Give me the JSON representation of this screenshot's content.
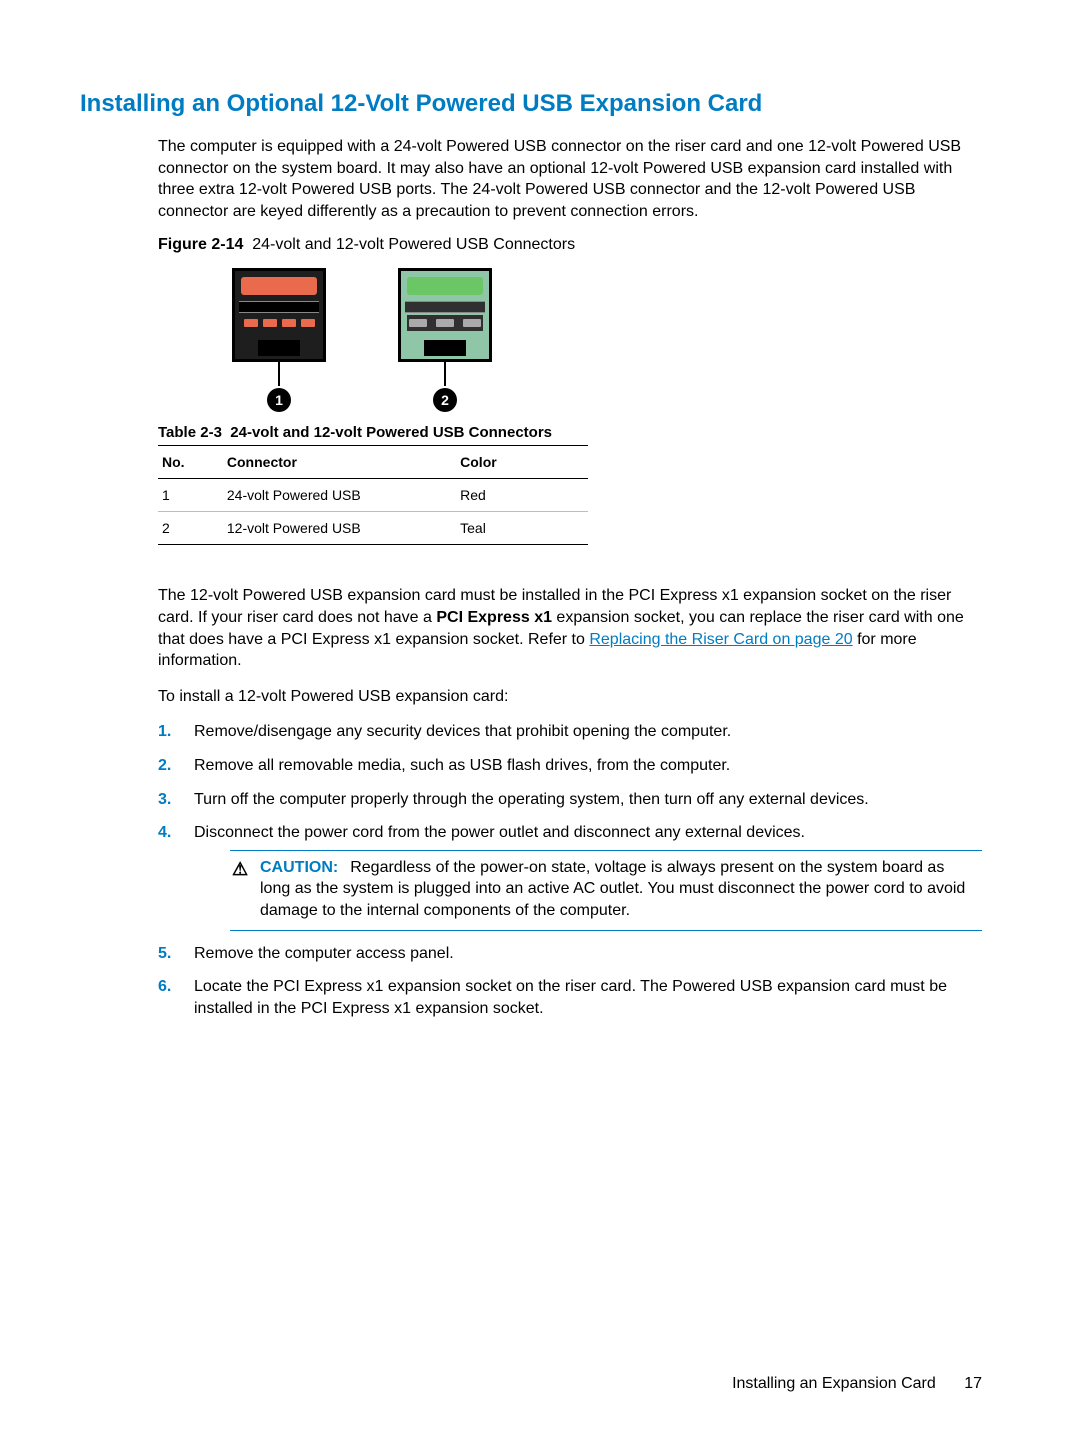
{
  "heading": "Installing an Optional 12-Volt Powered USB Expansion Card",
  "intro": "The computer is equipped with a 24-volt Powered USB connector on the riser card and one 12-volt Powered USB connector on the system board. It may also have an optional 12-volt Powered USB expansion card installed with three extra 12-volt Powered USB ports. The 24-volt Powered USB connector and the 12-volt Powered USB connector are keyed differently as a precaution to prevent connection errors.",
  "figure": {
    "number": "Figure 2-14",
    "caption": "24-volt and 12-volt Powered USB Connectors",
    "callouts": [
      "1",
      "2"
    ]
  },
  "table": {
    "number": "Table 2-3",
    "caption": "24-volt and 12-volt Powered USB Connectors",
    "headers": {
      "no": "No.",
      "connector": "Connector",
      "color": "Color"
    },
    "rows": [
      {
        "no": "1",
        "connector": "24-volt Powered USB",
        "color": "Red"
      },
      {
        "no": "2",
        "connector": "12-volt Powered USB",
        "color": "Teal"
      }
    ]
  },
  "para2": {
    "pre": "The 12-volt Powered USB expansion card must be installed in the PCI Express x1 expansion socket on the riser card. If your riser card does not have a ",
    "bold": "PCI Express x1",
    "mid": " expansion socket, you can replace the riser card with one that does have a PCI Express x1 expansion socket. Refer to ",
    "link": "Replacing the Riser Card on page 20",
    "post": " for more information."
  },
  "para3": "To install a 12-volt Powered USB expansion card:",
  "steps": [
    "Remove/disengage any security devices that prohibit opening the computer.",
    "Remove all removable media, such as USB flash drives, from the computer.",
    "Turn off the computer properly through the operating system, then turn off any external devices.",
    "Disconnect the power cord from the power outlet and disconnect any external devices.",
    "Remove the computer access panel.",
    "Locate the PCI Express x1 expansion socket on the riser card. The Powered USB expansion card must be installed in the PCI Express x1 expansion socket."
  ],
  "caution": {
    "label": "CAUTION:",
    "text": "Regardless of the power-on state, voltage is always present on the system board as long as the system is plugged into an active AC outlet. You must disconnect the power cord to avoid damage to the internal components of the computer."
  },
  "footer": {
    "section": "Installing an Expansion Card",
    "page": "17"
  }
}
